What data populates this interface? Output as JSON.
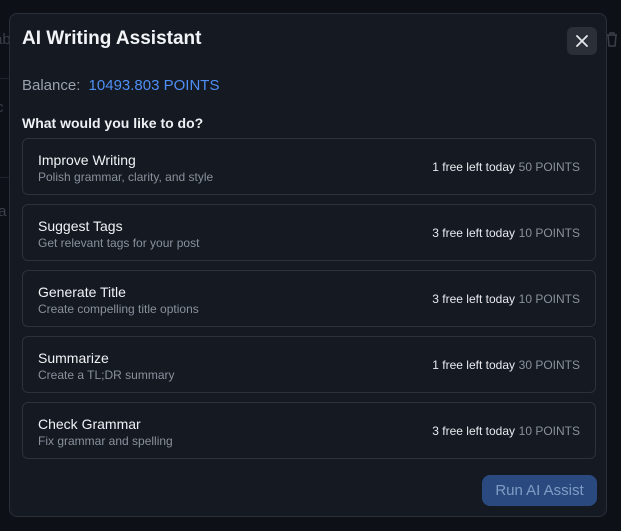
{
  "modal": {
    "title": "AI Writing Assistant",
    "balance_label": "Balance:",
    "balance_value": "10493.803 POINTS",
    "prompt": "What would you like to do?",
    "close_icon": "close-icon",
    "options": [
      {
        "title": "Improve Writing",
        "description": "Polish grammar, clarity, and style",
        "free": "1 free left today",
        "cost": "50 POINTS"
      },
      {
        "title": "Suggest Tags",
        "description": "Get relevant tags for your post",
        "free": "3 free left today",
        "cost": "10 POINTS"
      },
      {
        "title": "Generate Title",
        "description": "Create compelling title options",
        "free": "3 free left today",
        "cost": "10 POINTS"
      },
      {
        "title": "Summarize",
        "description": "Create a TL;DR summary",
        "free": "1 free left today",
        "cost": "30 POINTS"
      },
      {
        "title": "Check Grammar",
        "description": "Fix grammar and spelling",
        "free": "3 free left today",
        "cost": "10 POINTS"
      }
    ],
    "run_label": "Run AI Assist"
  },
  "background": {
    "fragments": [
      "ab",
      "c",
      "ta"
    ],
    "trash_icon": "trash-icon"
  },
  "colors": {
    "accent": "#4f8ff5",
    "modal_bg": "#141922",
    "run_button_bg": "#2a4a7f"
  }
}
